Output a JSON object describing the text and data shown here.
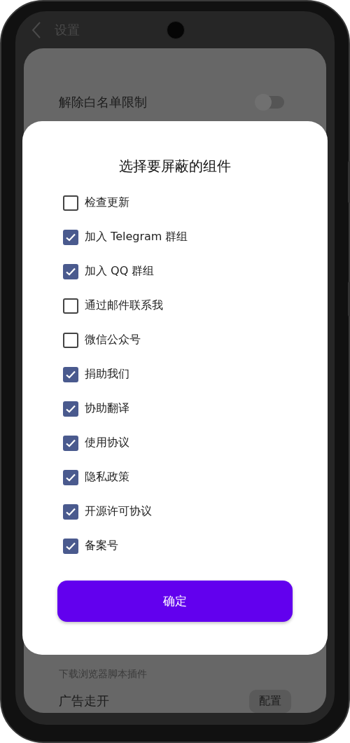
{
  "header": {
    "title": "设置"
  },
  "top_setting": {
    "title": "解除白名单限制",
    "on": false
  },
  "lower_settings": [
    {
      "subtitle": "下载浏览器脚本插件"
    },
    {
      "title": "广告走开",
      "button": "配置"
    }
  ],
  "dialog": {
    "title": "选择要屏蔽的组件",
    "options": [
      {
        "label": "检查更新",
        "checked": false
      },
      {
        "label": "加入 Telegram 群组",
        "checked": true
      },
      {
        "label": "加入 QQ 群组",
        "checked": true
      },
      {
        "label": "通过邮件联系我",
        "checked": false
      },
      {
        "label": "微信公众号",
        "checked": false
      },
      {
        "label": "捐助我们",
        "checked": true
      },
      {
        "label": "协助翻译",
        "checked": true
      },
      {
        "label": "使用协议",
        "checked": true
      },
      {
        "label": "隐私政策",
        "checked": true
      },
      {
        "label": "开源许可协议",
        "checked": true
      },
      {
        "label": "备案号",
        "checked": true
      }
    ],
    "confirm": "确定"
  }
}
